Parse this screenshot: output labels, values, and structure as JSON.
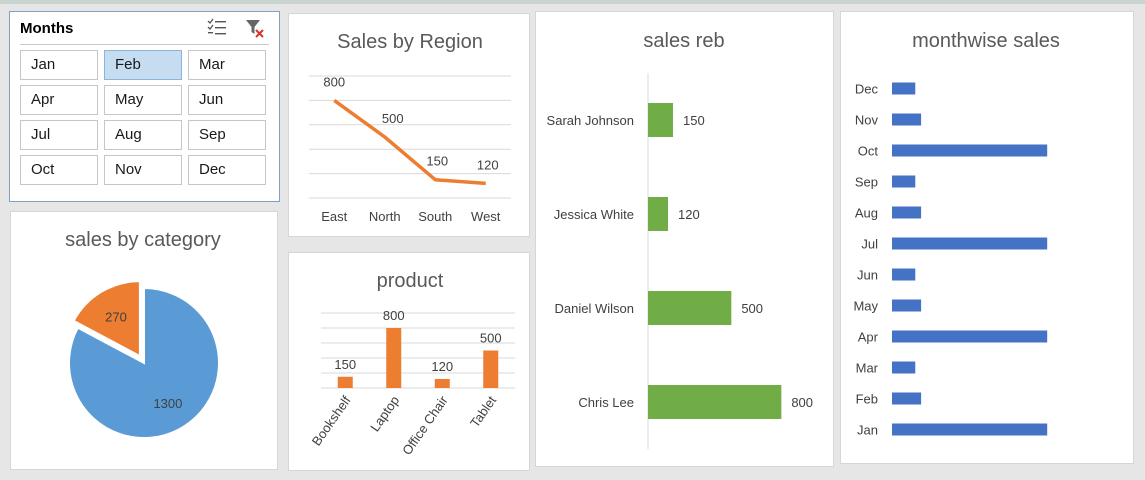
{
  "slicer": {
    "title": "Months",
    "selected": "Feb",
    "items": [
      "Jan",
      "Feb",
      "Mar",
      "Apr",
      "May",
      "Jun",
      "Jul",
      "Aug",
      "Sep",
      "Oct",
      "Nov",
      "Dec"
    ]
  },
  "colors": {
    "blue": "#5b9bd5",
    "orange": "#ed7d31",
    "green": "#70ad47",
    "darkblue": "#4472c4",
    "selected": "#c5dcf1"
  },
  "chart_data": [
    {
      "id": "region",
      "type": "line",
      "title": "Sales by Region",
      "categories": [
        "East",
        "North",
        "South",
        "West"
      ],
      "values": [
        800,
        500,
        150,
        120
      ],
      "ylim": [
        0,
        1000
      ],
      "grid": true,
      "color": "#ed7d31"
    },
    {
      "id": "category",
      "type": "pie",
      "title": "sales by category",
      "values": [
        270,
        1300
      ],
      "colors": [
        "#ed7d31",
        "#5b9bd5"
      ]
    },
    {
      "id": "product",
      "type": "bar",
      "title": "product",
      "categories": [
        "Bookshelf",
        "Laptop",
        "Office Chair",
        "Tablet"
      ],
      "values": [
        150,
        800,
        120,
        500
      ],
      "ylim": [
        0,
        1000
      ],
      "grid": true,
      "color": "#ed7d31"
    },
    {
      "id": "reb",
      "type": "bar",
      "orientation": "horizontal",
      "title": "sales reb",
      "categories": [
        "Sarah Johnson",
        "Jessica White",
        "Daniel Wilson",
        "Chris Lee"
      ],
      "values": [
        150,
        120,
        500,
        800
      ],
      "xlim": [
        0,
        900
      ],
      "color": "#70ad47"
    },
    {
      "id": "monthwise",
      "type": "bar",
      "orientation": "horizontal",
      "title": "monthwise sales",
      "categories": [
        "Dec",
        "Nov",
        "Oct",
        "Sep",
        "Aug",
        "Jul",
        "Jun",
        "May",
        "Apr",
        "Mar",
        "Feb",
        "Jan"
      ],
      "values": [
        120,
        150,
        800,
        120,
        150,
        800,
        120,
        150,
        800,
        120,
        150,
        800
      ],
      "xlim": [
        0,
        1000
      ],
      "color": "#4472c4"
    }
  ]
}
